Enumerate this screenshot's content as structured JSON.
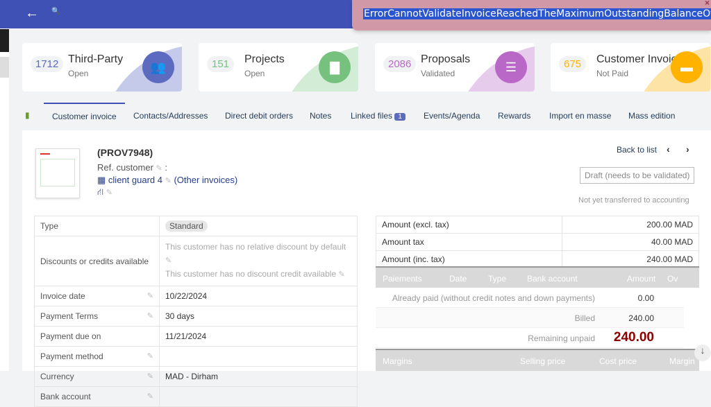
{
  "topbar": {
    "back": "←",
    "search": "🔍"
  },
  "error": {
    "message": "ErrorCannotValidateInvoiceReachedTheMaximumOutstandingBalanceOf",
    "close": "×"
  },
  "cards": [
    {
      "count": "1712",
      "title": "Third-Party",
      "sub": "Open",
      "color": "#5c6bc0",
      "wave": "#c5c9ea",
      "icon": "users-icon"
    },
    {
      "count": "151",
      "title": "Projects",
      "sub": "Open",
      "color": "#77c17e",
      "wave": "#d3ecd5",
      "icon": "file-icon"
    },
    {
      "count": "2086",
      "title": "Proposals",
      "sub": "Validated",
      "color": "#ba68c8",
      "wave": "#e6cbec",
      "icon": "document-icon"
    },
    {
      "count": "675",
      "title": "Customer Invoic",
      "sub": "Not Paid",
      "color": "#ffb300",
      "wave": "#fde3a6",
      "icon": "folder-icon"
    }
  ],
  "tabs": {
    "customer_invoice": "Customer invoice",
    "contacts": "Contacts/Addresses",
    "debit": "Direct debit orders",
    "notes": "Notes",
    "linked": "Linked files",
    "linked_count": "1",
    "events": "Events/Agenda",
    "rewards": "Rewards",
    "import": "Import en masse",
    "mass": "Mass edition"
  },
  "header": {
    "ref": "(PROV7948)",
    "ref_customer": "Ref. customer",
    "colon": ":",
    "client": "client guard 4",
    "other": "(Other invoices)",
    "back_to_list": "Back to list",
    "prev": "‹",
    "next": "›",
    "status": "Draft (needs to be validated)",
    "accounting": "Not yet transferred to accounting"
  },
  "fields": {
    "type_label": "Type",
    "type_value": "Standard",
    "discounts_label": "Discounts or credits available",
    "discount1": "This customer has no relative discount by default",
    "discount2": "This customer has no discount credit available",
    "invoice_date_label": "Invoice date",
    "invoice_date": "10/22/2024",
    "terms_label": "Payment Terms",
    "terms": "30 days",
    "due_label": "Payment due on",
    "due": "11/21/2024",
    "method_label": "Payment method",
    "currency_label": "Currency",
    "currency": "MAD - Dirham",
    "bank_label": "Bank account"
  },
  "amounts": {
    "excl_label": "Amount (excl. tax)",
    "excl": "200.00 MAD",
    "tax_label": "Amount tax",
    "tax": "40.00 MAD",
    "inc_label": "Amount (inc. tax)",
    "inc": "240.00 MAD"
  },
  "payments": {
    "h_payments": "Paiements",
    "h_date": "Date",
    "h_type": "Type",
    "h_bank": "Bank account",
    "h_amount": "Amount",
    "h_ov": "Ov",
    "already_label": "Already paid (without credit notes and down payments)",
    "already": "0.00",
    "billed_label": "Billed",
    "billed": "240.00",
    "remaining_label": "Remaining unpaid",
    "remaining": "240.00"
  },
  "margins": {
    "h_margins": "Margins",
    "h_selling": "Selling price",
    "h_cost": "Cost price",
    "h_margin": "Margin"
  }
}
